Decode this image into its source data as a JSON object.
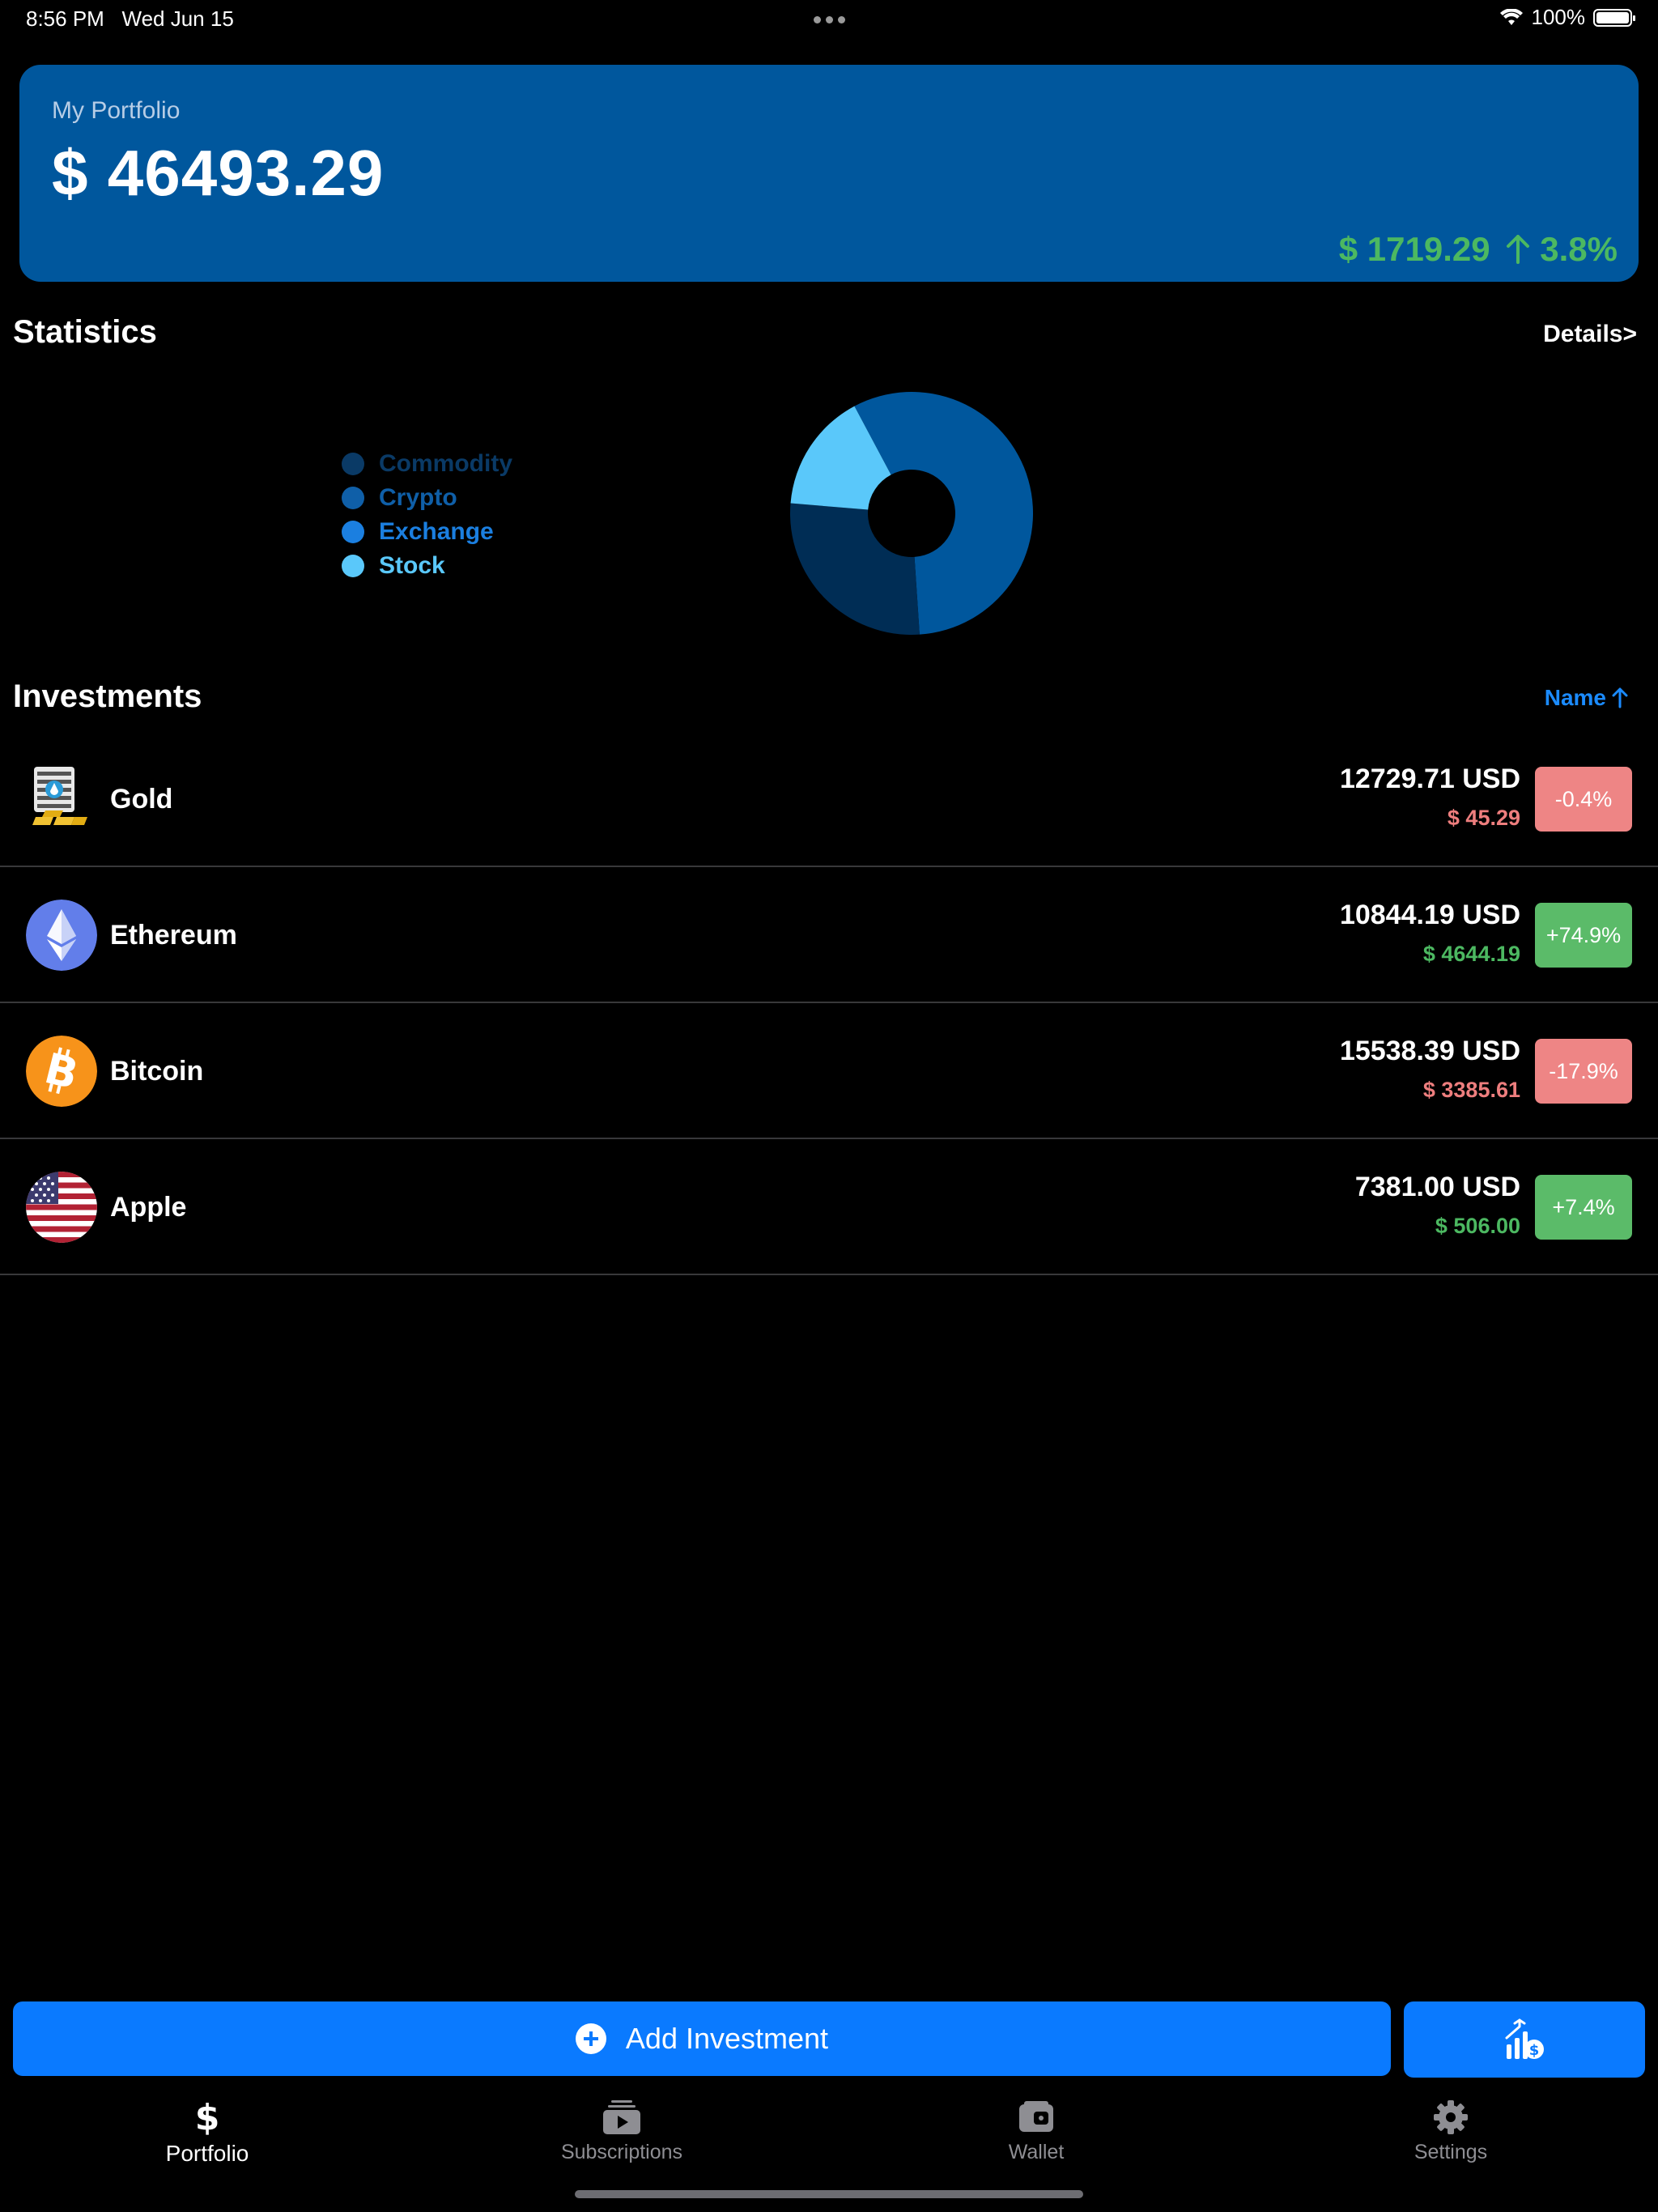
{
  "status_bar": {
    "time": "8:56 PM",
    "date": "Wed Jun 15",
    "battery": "100%",
    "battery_level": 1.0
  },
  "portfolio": {
    "label": "My Portfolio",
    "total": "$ 46493.29",
    "change_amount": "$ 1719.29",
    "change_percent": "3.8%",
    "change_color": "#4cb861",
    "card_color": "#00579d"
  },
  "statistics": {
    "title": "Statistics",
    "details_label": "Details>",
    "legend": [
      {
        "label": "Commodity",
        "color": "#0a3a66"
      },
      {
        "label": "Crypto",
        "color": "#0f5fa8"
      },
      {
        "label": "Exchange",
        "color": "#1b7fe0"
      },
      {
        "label": "Stock",
        "color": "#5ac8fa"
      }
    ]
  },
  "chart_data": {
    "type": "pie",
    "subtype": "donut",
    "labels": [
      "Crypto",
      "Commodity",
      "Stock"
    ],
    "values": [
      26382.58,
      12729.71,
      7381.0
    ],
    "colors": [
      "#00579d",
      "#002d55",
      "#5ac8fa"
    ]
  },
  "investments": {
    "title": "Investments",
    "sort_label": "Name",
    "items": [
      {
        "name": "Gold",
        "amount": "12729.71 USD",
        "change": "$ 45.29",
        "percent": "-0.4%",
        "direction": "down",
        "icon": "gold-bars-icon"
      },
      {
        "name": "Ethereum",
        "amount": "10844.19 USD",
        "change": "$ 4644.19",
        "percent": "+74.9%",
        "direction": "up",
        "icon": "ethereum-icon"
      },
      {
        "name": "Bitcoin",
        "amount": "15538.39 USD",
        "change": "$ 3385.61",
        "percent": "-17.9%",
        "direction": "down",
        "icon": "bitcoin-icon"
      },
      {
        "name": "Apple",
        "amount": "7381.00 USD",
        "change": "$ 506.00",
        "percent": "+7.4%",
        "direction": "up",
        "icon": "us-flag-icon"
      }
    ],
    "colors": {
      "up": "#4cb861",
      "down": "#ee7e7e",
      "badge_up": "#5bbb69",
      "badge_down": "#ee8585"
    }
  },
  "actions": {
    "add_investment": "Add Investment",
    "accent": "#0a7aff"
  },
  "tabbar": {
    "items": [
      {
        "label": "Portfolio",
        "icon": "dollar-icon",
        "active": true
      },
      {
        "label": "Subscriptions",
        "icon": "subscriptions-icon",
        "active": false
      },
      {
        "label": "Wallet",
        "icon": "wallet-icon",
        "active": false
      },
      {
        "label": "Settings",
        "icon": "gear-icon",
        "active": false
      }
    ]
  }
}
